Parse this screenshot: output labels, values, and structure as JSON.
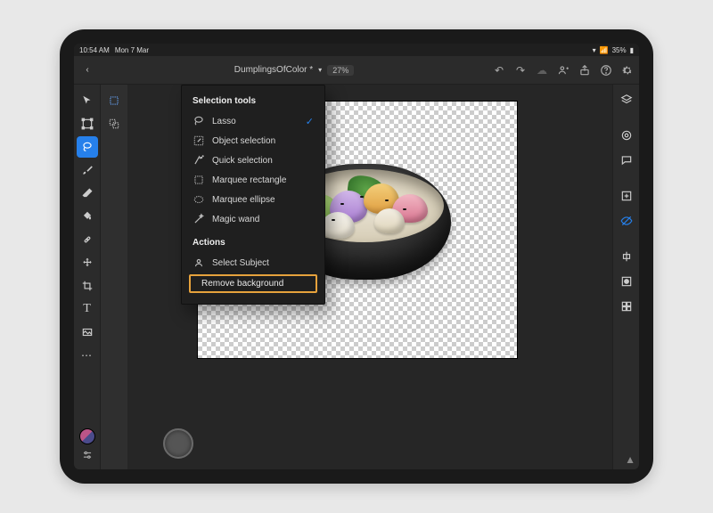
{
  "status": {
    "time": "10:54 AM",
    "date": "Mon 7 Mar",
    "battery": "35%"
  },
  "appbar": {
    "title": "DumplingsOfColor *",
    "zoom": "27%"
  },
  "flyout": {
    "heading_tools": "Selection tools",
    "heading_actions": "Actions",
    "items": [
      {
        "label": "Lasso",
        "checked": true
      },
      {
        "label": "Object selection"
      },
      {
        "label": "Quick selection"
      },
      {
        "label": "Marquee rectangle"
      },
      {
        "label": "Marquee ellipse"
      },
      {
        "label": "Magic wand"
      }
    ],
    "actions": [
      {
        "label": "Select Subject"
      },
      {
        "label": "Remove background",
        "highlight": true
      }
    ]
  }
}
